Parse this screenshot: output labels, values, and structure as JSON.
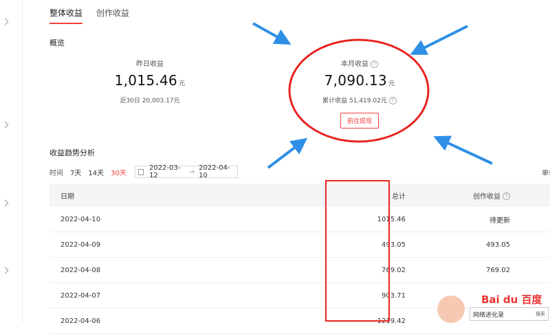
{
  "tabs": [
    {
      "label": "整体收益",
      "active": true
    },
    {
      "label": "创作收益",
      "active": false
    }
  ],
  "overview": {
    "title": "概览",
    "yesterday": {
      "label": "昨日收益",
      "value": "1,015.46",
      "unit": "元",
      "sub": "近30日 20,003.17元"
    },
    "month": {
      "label": "本月收益",
      "value": "7,090.13",
      "unit": "元",
      "sub": "累计收益 51,419.02元",
      "button": "前往提现"
    }
  },
  "trend": {
    "title": "收益趋势分析",
    "time_label": "时间",
    "ranges": [
      {
        "label": "7天",
        "active": false
      },
      {
        "label": "14天",
        "active": false
      },
      {
        "label": "30天",
        "active": true
      }
    ],
    "date_start": "2022-03-12",
    "date_sep": "→",
    "date_end": "2022-04-10",
    "unit_label": "单位"
  },
  "table": {
    "headers": {
      "date": "日期",
      "total": "总计",
      "create": "创作收益"
    },
    "rows": [
      {
        "date": "2022-04-10",
        "total": "1015.46",
        "create": "待更新"
      },
      {
        "date": "2022-04-09",
        "total": "493.05",
        "create": "493.05"
      },
      {
        "date": "2022-04-08",
        "total": "769.02",
        "create": "769.02"
      },
      {
        "date": "2022-04-07",
        "total": "903.71",
        "create": ""
      },
      {
        "date": "2022-04-06",
        "total": "1219.42",
        "create": ""
      }
    ]
  },
  "watermark": {
    "logo": "Bai du 百度",
    "bar_text": "网络进化录",
    "search": "搜索"
  },
  "colors": {
    "accent": "#f1403c",
    "annotation_red": "#e8231f",
    "annotation_blue": "#2f8fe6"
  }
}
